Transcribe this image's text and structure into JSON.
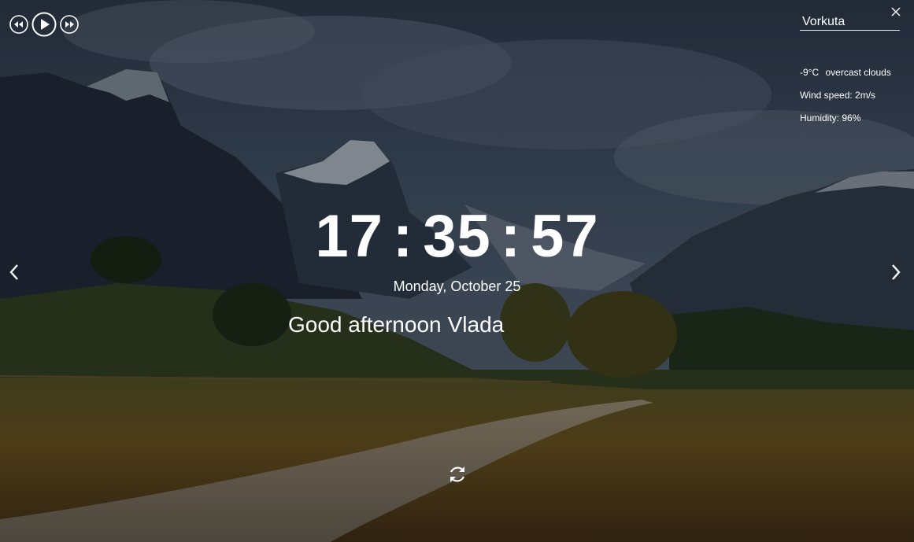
{
  "player": {
    "prev_icon": "rewind-icon",
    "play_icon": "play-icon",
    "next_icon": "fast-forward-icon"
  },
  "weather": {
    "city": "Vorkuta",
    "temperature": "-9°C",
    "description": "overcast clouds",
    "wind": "Wind speed: 2m/s",
    "humidity": "Humidity: 96%"
  },
  "clock": {
    "hours": "17",
    "minutes": "35",
    "seconds": "57",
    "separator": ":"
  },
  "date": "Monday, October 25",
  "greeting": {
    "text": "Good afternoon",
    "name": "Vlada"
  },
  "icons": {
    "prev_slide": "chevron-left-icon",
    "next_slide": "chevron-right-icon",
    "refresh_quote": "refresh-icon",
    "clear_city": "close-icon"
  },
  "colors": {
    "text": "#ffffff",
    "sky_dark": "#2e3c4e",
    "field_gold": "#6b5222"
  }
}
